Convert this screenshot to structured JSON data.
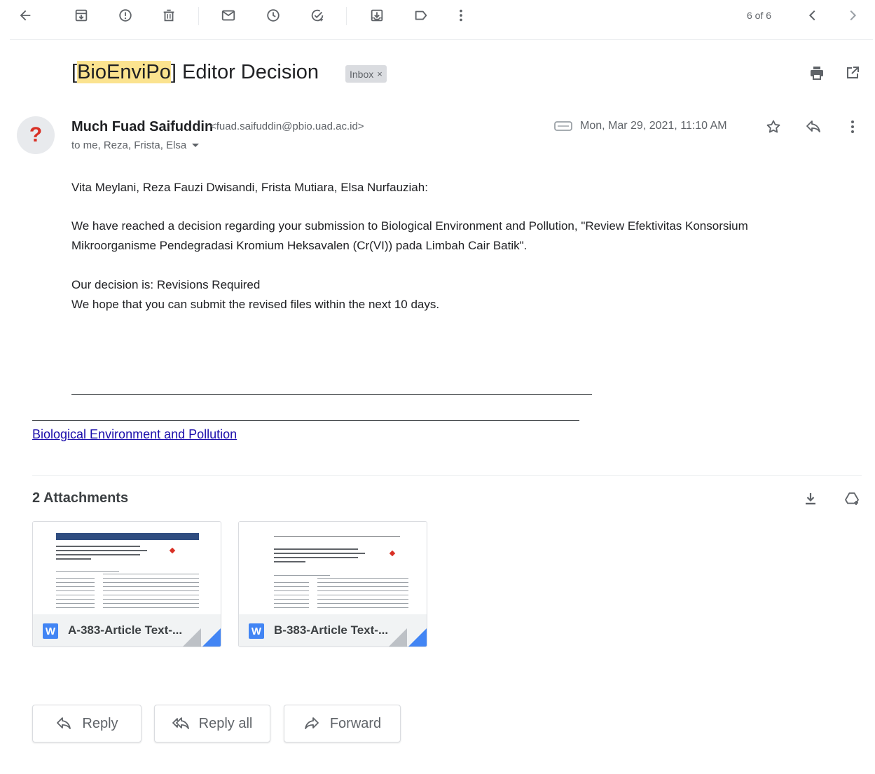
{
  "toolbar": {
    "counter": "6 of 6",
    "icons": [
      "back-arrow-icon",
      "archive-icon",
      "report-spam-icon",
      "delete-icon",
      "mark-unread-icon",
      "snooze-icon",
      "add-to-tasks-icon",
      "move-to-icon",
      "labels-icon",
      "more-vert-icon",
      "chevron-left-icon",
      "chevron-right-icon"
    ]
  },
  "subject": {
    "prefix": "[",
    "highlight": "BioEnviPo",
    "rest": "] Editor Decision",
    "label_chip": "Inbox",
    "label_chip_close": "×"
  },
  "sender": {
    "avatar_glyph": "?",
    "name": "Much Fuad Saifuddin",
    "email": "<fuad.saifuddin@pbio.uad.ac.id>",
    "recipients": "to me, Reza, Frista, Elsa",
    "date": "Mon, Mar 29, 2021, 11:10 AM"
  },
  "body": {
    "greeting": "Vita Meylani, Reza Fauzi Dwisandi, Frista Mutiara, Elsa Nurfauziah:",
    "para1_line1": "We have reached a decision regarding your submission to Biological Environment and Pollution, \"Review Efektivitas Konsorsium",
    "para1_line2": "Mikroorganisme Pendegradasi Kromium Heksavalen (Cr(VI)) pada Limbah Cair Batik\".",
    "decision": "Our decision is: Revisions Required",
    "hope": "We hope that you can submit the revised files within the next 10 days.",
    "journal_link": "Biological Environment and Pollution"
  },
  "attachments": {
    "title": "2 Attachments",
    "files": [
      {
        "name": "A-383-Article Text-...",
        "type_glyph": "W"
      },
      {
        "name": "B-383-Article Text-...",
        "type_glyph": "W"
      }
    ]
  },
  "actions": {
    "reply": "Reply",
    "reply_all": "Reply all",
    "forward": "Forward"
  },
  "colors": {
    "accent_blue": "#4285f4",
    "highlight_yellow": "#fbe38f",
    "avatar_red": "#d93025",
    "link": "#1a0dab"
  }
}
